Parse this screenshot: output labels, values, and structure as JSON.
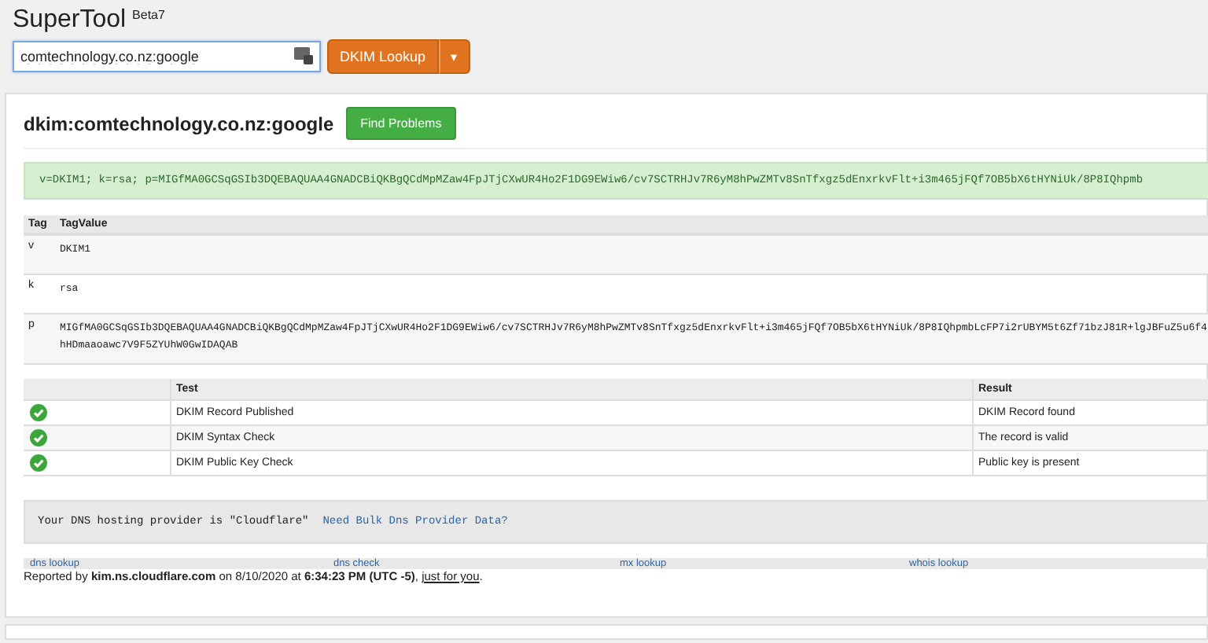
{
  "header": {
    "title": "SuperTool",
    "badge": "Beta7",
    "search": {
      "value": "comtechnology.co.nz:google"
    },
    "lookup_button": "DKIM Lookup",
    "dropdown_caret": "▾"
  },
  "result": {
    "heading": "dkim:comtechnology.co.nz:google",
    "find_button": "Find Problems",
    "record": "v=DKIM1; k=rsa; p=MIGfMA0GCSqGSIb3DQEBAQUAA4GNADCBiQKBgQCdMpMZaw4FpJTjCXwUR4Ho2F1DG9EWiw6/cv7SCTRHJv7R6yM8hPwZMTv8SnTfxgz5dEnxrkvFlt+i3m465jFQf7OB5bX6tHYNiUk/8P8IQhpmb",
    "tag_table": {
      "columns": [
        "Tag",
        "TagValue"
      ],
      "rows": [
        {
          "tag": "v",
          "value": "DKIM1"
        },
        {
          "tag": "k",
          "value": "rsa"
        },
        {
          "tag": "p",
          "value": "MIGfMA0GCSqGSIb3DQEBAQUAA4GNADCBiQKBgQCdMpMZaw4FpJTjCXwUR4Ho2F1DG9EWiw6/cv7SCTRHJv7R6yM8hPwZMTv8SnTfxgz5dEnxrkvFlt+i3m465jFQf7OB5bX6tHYNiUk/8P8IQhpmbLcFP7i2rUBYM5t6Zf71bzJ81R+lgJBFuZ5u6f4hHDmaaoawc7V9F5ZYUhW0GwIDAQAB"
        }
      ]
    },
    "test_table": {
      "columns": [
        "Test",
        "Result"
      ],
      "rows": [
        {
          "passed": true,
          "test": "DKIM Record Published",
          "result": "DKIM Record found"
        },
        {
          "passed": true,
          "test": "DKIM Syntax Check",
          "result": "The record is valid"
        },
        {
          "passed": true,
          "test": "DKIM Public Key Check",
          "result": "Public key is present"
        }
      ]
    },
    "dns_note": {
      "text": "Your DNS hosting provider is \"Cloudflare\"",
      "link": "Need Bulk Dns Provider Data?"
    },
    "footer_links": [
      "dns lookup",
      "dns check",
      "mx lookup",
      "whois lookup"
    ],
    "reported": "Reported by **kim.ns.cloudflare.com** on 8/10/2020 at **6:34:23 PM (UTC -5)**,",
    "reported_link": "just for you",
    "reported_end": "."
  }
}
